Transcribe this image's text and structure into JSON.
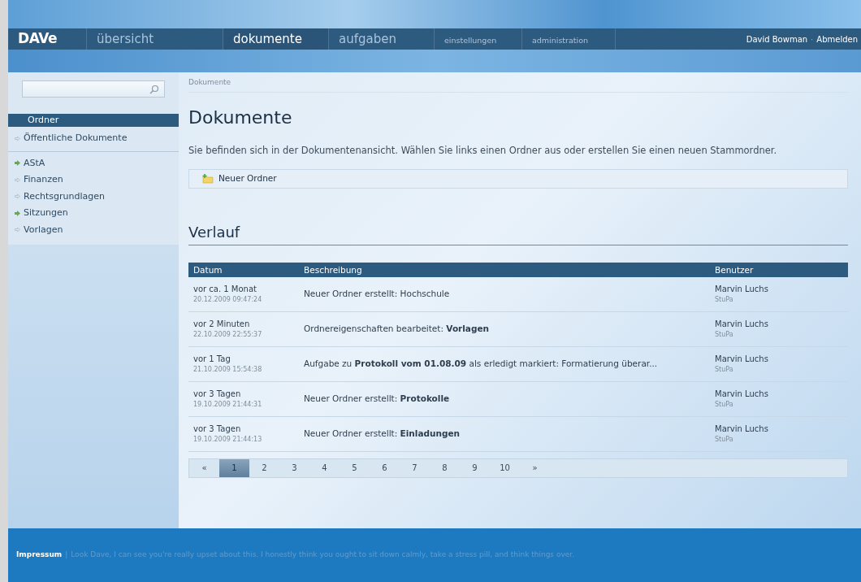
{
  "header": {
    "logo": "DAVe",
    "nav": [
      {
        "label": "übersicht",
        "kind": "main",
        "selected": false
      },
      {
        "label": "dokumente",
        "kind": "main",
        "selected": true
      },
      {
        "label": "aufgaben",
        "kind": "main",
        "selected": false
      },
      {
        "label": "einstellungen",
        "kind": "minor",
        "selected": false
      },
      {
        "label": "administration",
        "kind": "minor",
        "selected": false
      }
    ],
    "user": "David Bowman",
    "separator": "·",
    "logout": "Abmelden"
  },
  "sidebar": {
    "heading": "Ordner",
    "public": {
      "label": "Öffentliche Dokumente",
      "has_subfolders": false
    },
    "folders": [
      {
        "label": "AStA",
        "has_subfolders": true
      },
      {
        "label": "Finanzen",
        "has_subfolders": false
      },
      {
        "label": "Rechtsgrundlagen",
        "has_subfolders": false
      },
      {
        "label": "Sitzungen",
        "has_subfolders": true
      },
      {
        "label": "Vorlagen",
        "has_subfolders": false
      }
    ]
  },
  "breadcrumb": "Dokumente",
  "title": "Dokumente",
  "intro": "Sie befinden sich in der Dokumentenansicht. Wählen Sie links einen Ordner aus oder erstellen Sie einen neuen Stammordner.",
  "new_folder_button": "Neuer Ordner",
  "history": {
    "title": "Verlauf",
    "columns": [
      "Datum",
      "Beschreibung",
      "Benutzer"
    ],
    "rows": [
      {
        "relative": "vor ca. 1 Monat",
        "date": "20.12.2009 09:47:24",
        "description": "Neuer Ordner erstellt: Hochschule",
        "user": "Marvin Luchs",
        "group": "StuPa"
      },
      {
        "relative": "vor 2 Minuten",
        "date": "22.10.2009 22:55:37",
        "description": "Ordnereigenschaften bearbeitet: **Vorlagen**",
        "user": "Marvin Luchs",
        "group": "StuPa"
      },
      {
        "relative": "vor 1 Tag",
        "date": "21.10.2009 15:54:38",
        "description": "Aufgabe zu **Protokoll vom 01.08.09** als erledigt markiert: Formatierung überar...",
        "user": "Marvin Luchs",
        "group": "StuPa"
      },
      {
        "relative": "vor 3 Tagen",
        "date": "19.10.2009 21:44:31",
        "description": "Neuer Ordner erstellt: **Protokolle**",
        "user": "Marvin Luchs",
        "group": "StuPa"
      },
      {
        "relative": "vor 3 Tagen",
        "date": "19.10.2009 21:44:13",
        "description": "Neuer Ordner erstellt: **Einladungen**",
        "user": "Marvin Luchs",
        "group": "StuPa"
      }
    ]
  },
  "pagination": {
    "prev": "«",
    "pages": [
      {
        "label": "1",
        "selected": true
      },
      {
        "label": "2",
        "selected": false
      },
      {
        "label": "3",
        "selected": false
      },
      {
        "label": "4",
        "selected": false
      },
      {
        "label": "5",
        "selected": false
      },
      {
        "label": "6",
        "selected": false
      },
      {
        "label": "7",
        "selected": false
      },
      {
        "label": "8",
        "selected": false
      },
      {
        "label": "9",
        "selected": false
      },
      {
        "label": "10",
        "selected": false
      }
    ],
    "next": "»"
  },
  "footer": {
    "link": "Impressum",
    "separator": "|",
    "quote": "Look Dave, I can see you're really upset about this. I honestly think you ought to sit down calmly, take a stress pill, and think things over."
  }
}
